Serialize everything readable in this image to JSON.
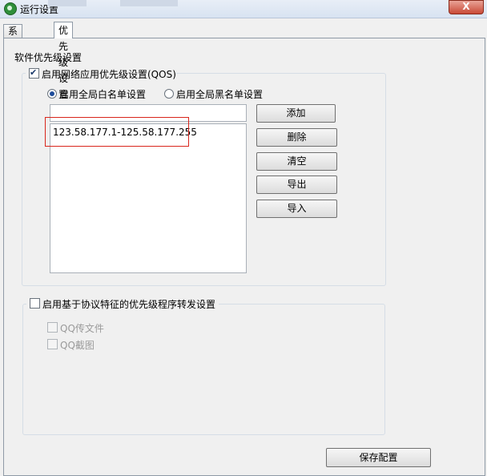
{
  "window": {
    "title": "运行设置",
    "close_label": "X"
  },
  "tabs": [
    {
      "label": "系统设置",
      "active": false
    },
    {
      "label": "优先级设置",
      "active": true
    }
  ],
  "section_title": "软件优先级设置",
  "qos": {
    "enable_label": "启用网络应用优先级设置(QOS)",
    "enabled": true,
    "whitelist_label": "启用全局白名单设置",
    "blacklist_label": "启用全局黑名单设置",
    "selected_mode": "whitelist",
    "input_value": "",
    "list_items": [
      "123.58.177.1-125.58.177.255"
    ],
    "buttons": {
      "add": "添加",
      "delete": "删除",
      "clear": "清空",
      "export": "导出",
      "import": "导入"
    }
  },
  "protocol": {
    "enable_label": "启用基于协议特征的优先级程序转发设置",
    "enabled": false,
    "items": [
      {
        "label": "QQ传文件",
        "checked": false
      },
      {
        "label": "QQ截图",
        "checked": false
      }
    ]
  },
  "save_button": "保存配置",
  "colors": {
    "highlight_border": "#d9261c",
    "titlebar": "#dce6f3",
    "close_button": "#c94a36"
  }
}
